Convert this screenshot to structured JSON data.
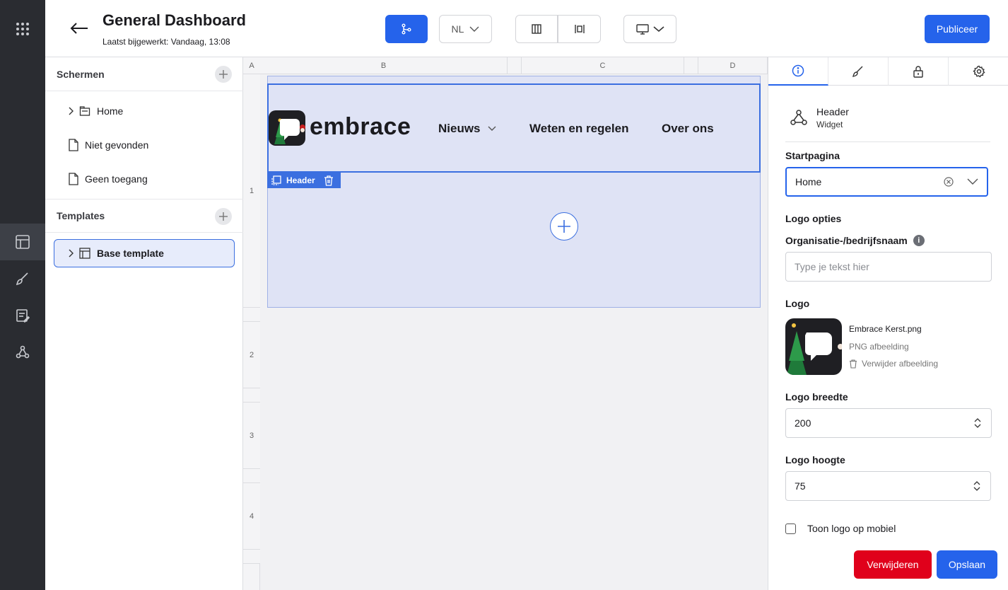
{
  "app": {
    "title": "General Dashboard",
    "subtitle": "Laatst bijgewerkt: Vandaag, 13:08"
  },
  "toolbar": {
    "language": "NL",
    "publish_label": "Publiceer"
  },
  "left": {
    "screens_title": "Schermen",
    "screens": [
      {
        "label": "Home"
      },
      {
        "label": "Niet gevonden"
      },
      {
        "label": "Geen toegang"
      }
    ],
    "templates_title": "Templates",
    "templates": [
      {
        "label": "Base template"
      }
    ]
  },
  "canvas": {
    "columns": [
      "A",
      "B",
      "C",
      "D"
    ],
    "rows": [
      "1",
      "2",
      "3",
      "4"
    ],
    "header": {
      "logo_text": "embrace",
      "nav": [
        "Nieuws",
        "Weten en regelen",
        "Over ons"
      ]
    },
    "widget_label": "Header"
  },
  "panel": {
    "widget_name": "Header",
    "widget_type": "Widget",
    "start_label": "Startpagina",
    "start_value": "Home",
    "logo_options": "Logo opties",
    "org_label": "Organisatie-/bedrijfsnaam",
    "org_placeholder": "Type je tekst hier",
    "logo_label": "Logo",
    "logo_file": "Embrace Kerst.png",
    "logo_type": "PNG afbeelding",
    "logo_remove": "Verwijder afbeelding",
    "width_label": "Logo breedte",
    "width_value": "200",
    "height_label": "Logo hoogte",
    "height_value": "75",
    "mobile_label": "Toon logo op mobiel",
    "delete_label": "Verwijderen",
    "save_label": "Opslaan"
  },
  "colors": {
    "accent": "#2563eb",
    "danger": "#e0001b",
    "rail": "#2a2c31",
    "selection": "#dfe3f5"
  }
}
